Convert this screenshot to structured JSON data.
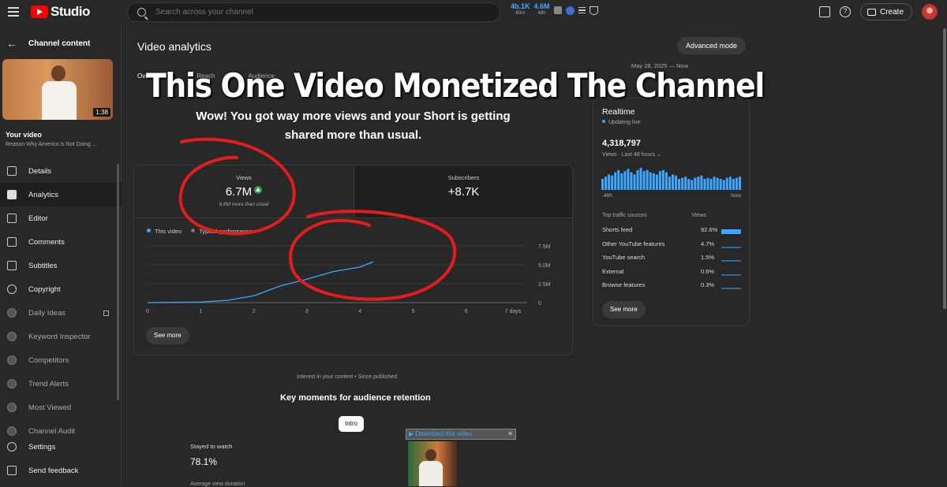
{
  "topbar": {
    "logo_text": "Studio",
    "search_placeholder": "Search across your channel",
    "ext_stats": [
      {
        "value": "4b.1K",
        "sub": "60m"
      },
      {
        "value": "4.6M",
        "sub": "48h"
      }
    ],
    "create_label": "Create"
  },
  "sidebar": {
    "back_label": "Channel content",
    "thumb_duration": "1:38",
    "your_video_label": "Your video",
    "video_title": "Reason Why America Is Not Doing ...",
    "items": [
      {
        "label": "Details",
        "icon": "pencil-icon"
      },
      {
        "label": "Analytics",
        "icon": "analytics-icon"
      },
      {
        "label": "Editor",
        "icon": "editor-icon"
      },
      {
        "label": "Comments",
        "icon": "comments-icon"
      },
      {
        "label": "Subtitles",
        "icon": "subtitles-icon"
      },
      {
        "label": "Copyright",
        "icon": "copyright-icon"
      },
      {
        "label": "Daily Ideas",
        "icon": "daily-ideas-icon"
      },
      {
        "label": "Keyword Inspector",
        "icon": "keyword-inspector-icon"
      },
      {
        "label": "Competitors",
        "icon": "competitors-icon"
      },
      {
        "label": "Trend Alerts",
        "icon": "trend-alerts-icon"
      },
      {
        "label": "Most Viewed",
        "icon": "most-viewed-icon"
      },
      {
        "label": "Channel Audit",
        "icon": "channel-audit-icon"
      }
    ],
    "bottom": [
      {
        "label": "Settings",
        "icon": "gear-icon"
      },
      {
        "label": "Send feedback",
        "icon": "feedback-icon"
      }
    ]
  },
  "main": {
    "page_title": "Video analytics",
    "advanced_mode": "Advanced mode",
    "date_range": "May 28, 2025 — Now",
    "date_range_sub": "Since published",
    "tabs": [
      "Overview",
      "Reach",
      "Audience"
    ],
    "headline": "This One Video Monetized The Channel",
    "sub_banner": "Wow! You got way more views and your Short is getting shared more than usual.",
    "views_card": {
      "label": "Views",
      "value": "6.7M",
      "note": "6.6M more than usual"
    },
    "subs_card": {
      "label": "Subscribers",
      "value": "+8.7K"
    },
    "legend": {
      "this_video": "This video",
      "typical": "Typical performance"
    },
    "see_more": "See more",
    "interest": "Interest in your content • Since published",
    "key_moments_title": "Key moments for audience retention",
    "intro_btn": "Intro",
    "stayed_label": "Stayed to watch",
    "stayed_value": "78.1%",
    "avg_label": "Average view duration",
    "download_bar": "Download this video"
  },
  "chart_data": {
    "type": "line",
    "x": [
      0,
      1,
      2,
      3,
      4,
      5,
      6,
      7
    ],
    "x_tick_labels": [
      "0",
      "1",
      "2",
      "3",
      "4",
      "5",
      "6",
      "7 days"
    ],
    "y_tick_labels": [
      "0",
      "2.5M",
      "5.0M",
      "7.5M"
    ],
    "ylim": [
      0,
      7500000
    ],
    "series": [
      {
        "name": "This video",
        "color": "#3ea6ff",
        "points": [
          [
            0,
            0
          ],
          [
            0.5,
            30000
          ],
          [
            1,
            80000
          ],
          [
            1.5,
            300000
          ],
          [
            2,
            900000
          ],
          [
            2.5,
            2200000
          ],
          [
            3,
            3100000
          ],
          [
            3.5,
            4100000
          ],
          [
            4,
            4700000
          ],
          [
            4.25,
            5400000
          ]
        ]
      }
    ]
  },
  "realtime": {
    "title": "Realtime",
    "live": "Updating live",
    "value": "4,318,797",
    "views_label": "Views · Last 48 hours",
    "axis_start": "-48h",
    "axis_end": "Now",
    "src_head_left": "Top traffic sources",
    "src_head_right": "Views",
    "sources": [
      {
        "label": "Shorts feed",
        "pct": "92.6%"
      },
      {
        "label": "Other YouTube features",
        "pct": "4.7%"
      },
      {
        "label": "YouTube search",
        "pct": "1.5%"
      },
      {
        "label": "External",
        "pct": "0.6%"
      },
      {
        "label": "Browse features",
        "pct": "0.3%"
      }
    ],
    "see_more": "See more",
    "bars": [
      0.5,
      0.6,
      0.7,
      0.65,
      0.8,
      0.9,
      0.75,
      0.85,
      0.95,
      0.8,
      0.7,
      0.9,
      1,
      0.85,
      0.9,
      0.8,
      0.75,
      0.7,
      0.85,
      0.9,
      0.8,
      0.6,
      0.7,
      0.65,
      0.5,
      0.55,
      0.6,
      0.5,
      0.45,
      0.55,
      0.6,
      0.65,
      0.5,
      0.55,
      0.5,
      0.6,
      0.55,
      0.5,
      0.45,
      0.55,
      0.6,
      0.5,
      0.55,
      0.6
    ]
  }
}
